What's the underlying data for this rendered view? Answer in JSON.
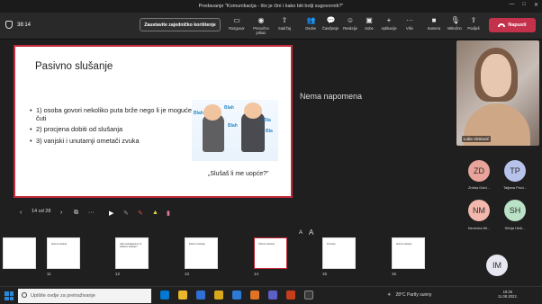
{
  "window": {
    "title": "Predavanje \"Komunikacija - što je čini i kako biti bolji sugovornik?\""
  },
  "toolbar": {
    "timer": "38:14",
    "stop_sharing": "Zaustavite zajedničko korištenje",
    "tools": [
      {
        "label": "Razgovor",
        "icon": "chat-icon"
      },
      {
        "label": "Prenočno prikaz",
        "icon": "eye-icon"
      },
      {
        "label": "Sadržaj",
        "icon": "share-icon"
      },
      {
        "label": "Osobe",
        "icon": "people-icon",
        "badge": "2"
      },
      {
        "label": "Čavrljanje",
        "icon": "chat-bubble-icon"
      },
      {
        "label": "Reakcije",
        "icon": "emoji-icon"
      },
      {
        "label": "Sobe",
        "icon": "rooms-icon"
      },
      {
        "label": "Aplikacije",
        "icon": "plus-icon"
      },
      {
        "label": "Više",
        "icon": "ellipsis-icon"
      },
      {
        "label": "Kamera",
        "icon": "camera-icon"
      },
      {
        "label": "Mikrofon",
        "icon": "mic-icon"
      },
      {
        "label": "Podijeli",
        "icon": "share-up-icon"
      }
    ],
    "leave_label": "Napusti",
    "accent": "#c4314b"
  },
  "slide": {
    "title": "Pasivno slušanje",
    "bullets": [
      "1) osoba govori nekoliko puta brže nego li je moguće čuti",
      "2) procjena dobiti od slušanja",
      "3) vanjski i unutarnji ometači zvuka"
    ],
    "caption": "„Slušaš li me uopće?\"",
    "illustration_words": [
      "Blah",
      "Blah",
      "Blah",
      "Bla",
      "Bla"
    ]
  },
  "notes": {
    "label": "Nema napomena"
  },
  "presenter": {
    "page_label": "14 od 28",
    "font_decrease": "A",
    "font_increase": "A"
  },
  "participants": {
    "video_name": "Lidia Vinković",
    "people": [
      {
        "initials": "ZD",
        "name": "Zrinka Dold...",
        "color": "#e8a49a"
      },
      {
        "initials": "TP",
        "name": "Tatjana Prod...",
        "color": "#b7c3ea"
      },
      {
        "initials": "NM",
        "name": "Nevenka Mi...",
        "color": "#f2b7ad"
      },
      {
        "initials": "SH",
        "name": "Silvija Hešl...",
        "color": "#b9e2c6"
      },
      {
        "initials": "IM",
        "name": "",
        "color": "#e7e7f2"
      }
    ]
  },
  "thumbnails": [
    {
      "num": "",
      "title": ""
    },
    {
      "num": "11",
      "title": "Aktivno slušanje"
    },
    {
      "num": "12",
      "title": "Kako poboljšavamo za efikasno slušanje?"
    },
    {
      "num": "13",
      "title": "Pasivno slušanje"
    },
    {
      "num": "14",
      "title": "Pasivno slušanje"
    },
    {
      "num": "15",
      "title": "Prepreke"
    },
    {
      "num": "16",
      "title": "Aktivno slušanje"
    }
  ],
  "taskbar": {
    "search_placeholder": "Upišite ovdje za pretraživanje",
    "weather": "28°C  Partly sunny",
    "time": "18:25",
    "date": "11.08.2022."
  }
}
